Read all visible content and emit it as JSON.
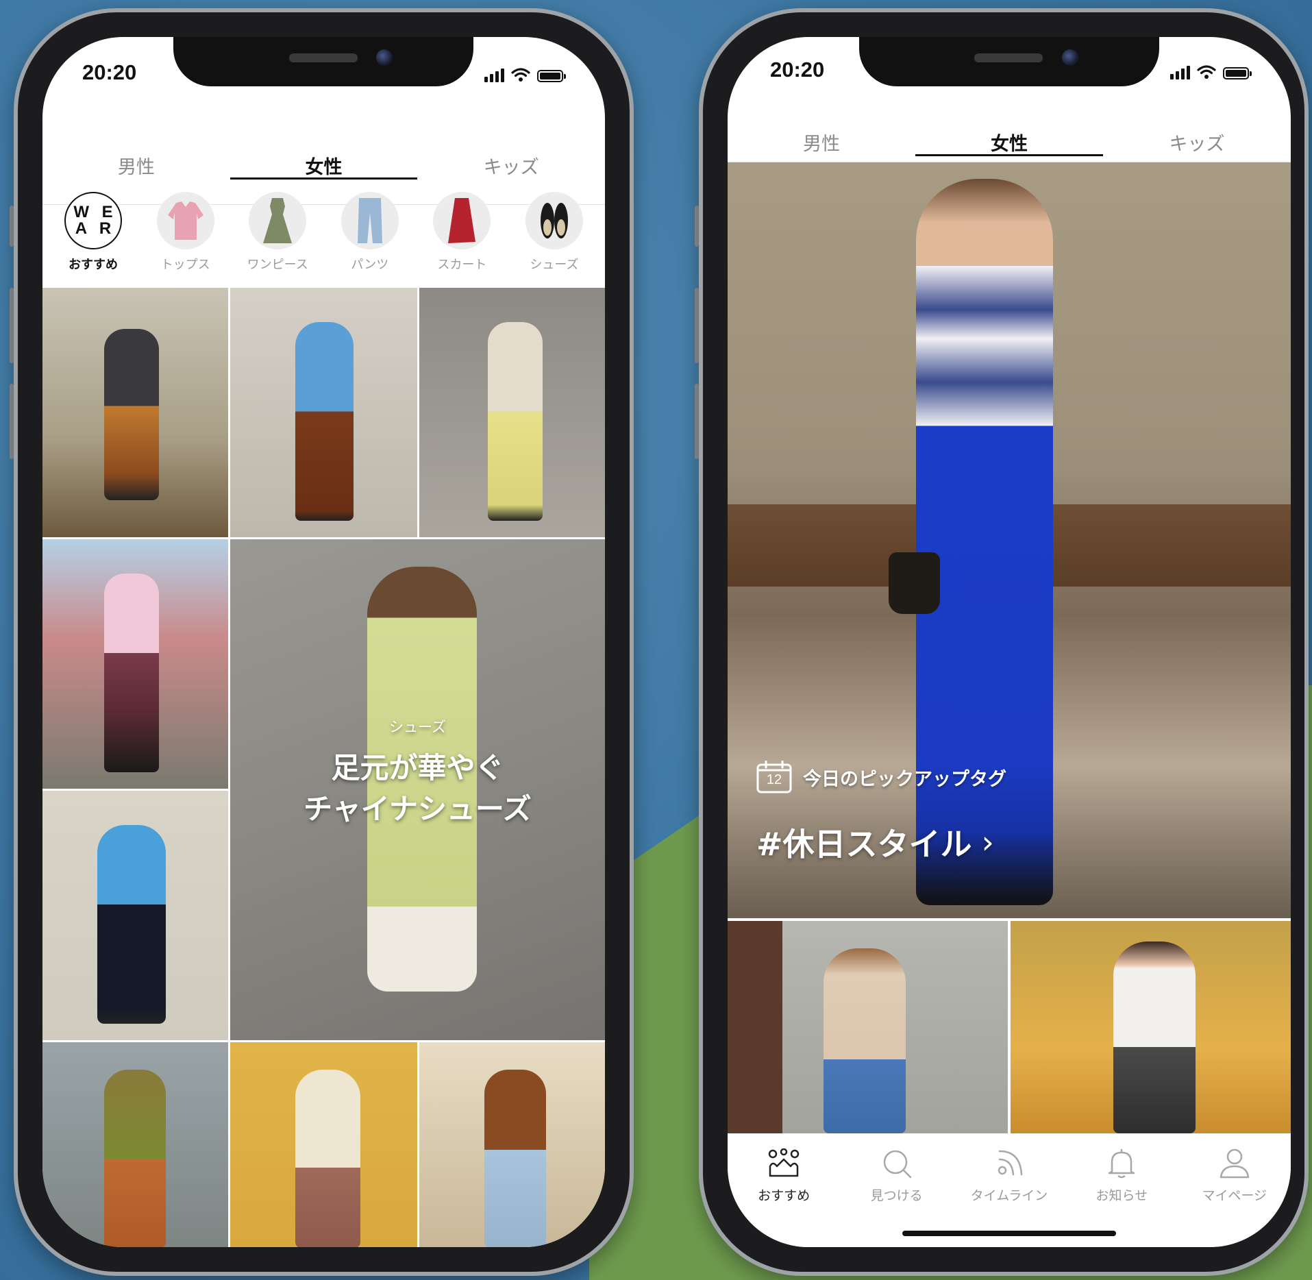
{
  "colors": {
    "background_blue": "#3d77a3",
    "background_green": "#6e9a4e",
    "text_primary": "#111111",
    "text_muted": "#9a9a9a"
  },
  "phone_left": {
    "status": {
      "time": "20:20",
      "icons": [
        "signal-icon",
        "wifi-icon",
        "battery-icon"
      ]
    },
    "tabs": [
      {
        "label": "男性",
        "active": false
      },
      {
        "label": "女性",
        "active": true
      },
      {
        "label": "キッズ",
        "active": false
      }
    ],
    "categories": [
      {
        "label": "おすすめ",
        "icon": "wear-logo-icon",
        "logo_text": [
          "W E",
          "A R"
        ],
        "active": true
      },
      {
        "label": "トップス",
        "icon": "blouse-icon"
      },
      {
        "label": "ワンピース",
        "icon": "dress-icon"
      },
      {
        "label": "パンツ",
        "icon": "jeans-icon"
      },
      {
        "label": "スカート",
        "icon": "skirt-icon"
      },
      {
        "label": "シューズ",
        "icon": "shoes-icon"
      }
    ],
    "featured": {
      "category": "シューズ",
      "title_line1": "足元が華やぐ",
      "title_line2": "チャイナシューズ"
    }
  },
  "phone_right": {
    "status": {
      "time": "20:20",
      "icons": [
        "signal-icon",
        "wifi-icon",
        "battery-icon"
      ]
    },
    "tabs": [
      {
        "label": "男性",
        "active": false
      },
      {
        "label": "女性",
        "active": true
      },
      {
        "label": "キッズ",
        "active": false
      }
    ],
    "hero": {
      "calendar_day": "12",
      "caption": "今日のピックアップタグ",
      "tag": "#休日スタイル",
      "chevron": "›"
    },
    "bottom_nav": [
      {
        "label": "おすすめ",
        "icon": "crown-people-icon",
        "active": true
      },
      {
        "label": "見つける",
        "icon": "search-icon",
        "active": false
      },
      {
        "label": "タイムライン",
        "icon": "feed-icon",
        "active": false
      },
      {
        "label": "お知らせ",
        "icon": "bell-icon",
        "active": false
      },
      {
        "label": "マイページ",
        "icon": "person-icon",
        "active": false
      }
    ]
  }
}
